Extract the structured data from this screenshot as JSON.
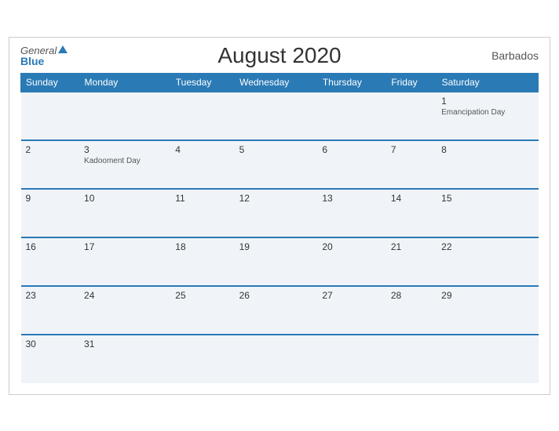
{
  "header": {
    "logo_general": "General",
    "logo_blue": "Blue",
    "title": "August 2020",
    "country": "Barbados"
  },
  "days_of_week": [
    "Sunday",
    "Monday",
    "Tuesday",
    "Wednesday",
    "Thursday",
    "Friday",
    "Saturday"
  ],
  "weeks": [
    [
      {
        "day": "",
        "event": ""
      },
      {
        "day": "",
        "event": ""
      },
      {
        "day": "",
        "event": ""
      },
      {
        "day": "",
        "event": ""
      },
      {
        "day": "",
        "event": ""
      },
      {
        "day": "",
        "event": ""
      },
      {
        "day": "1",
        "event": "Emancipation Day"
      }
    ],
    [
      {
        "day": "2",
        "event": ""
      },
      {
        "day": "3",
        "event": "Kadooment Day"
      },
      {
        "day": "4",
        "event": ""
      },
      {
        "day": "5",
        "event": ""
      },
      {
        "day": "6",
        "event": ""
      },
      {
        "day": "7",
        "event": ""
      },
      {
        "day": "8",
        "event": ""
      }
    ],
    [
      {
        "day": "9",
        "event": ""
      },
      {
        "day": "10",
        "event": ""
      },
      {
        "day": "11",
        "event": ""
      },
      {
        "day": "12",
        "event": ""
      },
      {
        "day": "13",
        "event": ""
      },
      {
        "day": "14",
        "event": ""
      },
      {
        "day": "15",
        "event": ""
      }
    ],
    [
      {
        "day": "16",
        "event": ""
      },
      {
        "day": "17",
        "event": ""
      },
      {
        "day": "18",
        "event": ""
      },
      {
        "day": "19",
        "event": ""
      },
      {
        "day": "20",
        "event": ""
      },
      {
        "day": "21",
        "event": ""
      },
      {
        "day": "22",
        "event": ""
      }
    ],
    [
      {
        "day": "23",
        "event": ""
      },
      {
        "day": "24",
        "event": ""
      },
      {
        "day": "25",
        "event": ""
      },
      {
        "day": "26",
        "event": ""
      },
      {
        "day": "27",
        "event": ""
      },
      {
        "day": "28",
        "event": ""
      },
      {
        "day": "29",
        "event": ""
      }
    ],
    [
      {
        "day": "30",
        "event": ""
      },
      {
        "day": "31",
        "event": ""
      },
      {
        "day": "",
        "event": ""
      },
      {
        "day": "",
        "event": ""
      },
      {
        "day": "",
        "event": ""
      },
      {
        "day": "",
        "event": ""
      },
      {
        "day": "",
        "event": ""
      }
    ]
  ]
}
